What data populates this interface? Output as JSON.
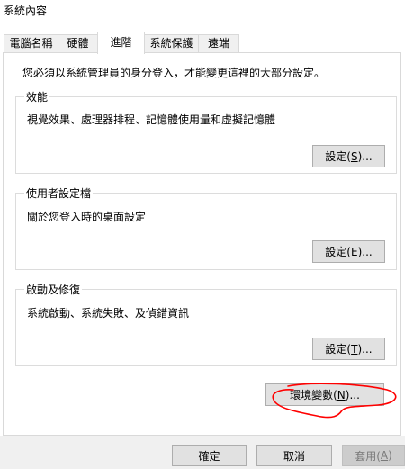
{
  "window": {
    "title": "系統內容"
  },
  "tabs": [
    {
      "label": "電腦名稱"
    },
    {
      "label": "硬體"
    },
    {
      "label": "進階"
    },
    {
      "label": "系統保護"
    },
    {
      "label": "遠端"
    }
  ],
  "active_tab": "進階",
  "advanced": {
    "notice": "您必須以系統管理員的身分登入，才能變更這裡的大部分設定。",
    "performance": {
      "title": "效能",
      "description": "視覺效果、處理器排程、記憶體使用量和虛擬記憶體",
      "button": {
        "text": "設定(",
        "accel": "S",
        "suffix": ")..."
      }
    },
    "user_profiles": {
      "title": "使用者設定檔",
      "description": "關於您登入時的桌面設定",
      "button": {
        "text": "設定(",
        "accel": "E",
        "suffix": ")..."
      }
    },
    "startup_recovery": {
      "title": "啟動及修復",
      "description": "系統啟動、系統失敗、及偵錯資訊",
      "button": {
        "text": "設定(",
        "accel": "T",
        "suffix": ")..."
      }
    },
    "env_vars_button": {
      "text": "環境變數(",
      "accel": "N",
      "suffix": ")..."
    }
  },
  "dialog_buttons": {
    "ok": "確定",
    "cancel": "取消",
    "apply": {
      "text": "套用(",
      "accel": "A",
      "suffix": ")"
    }
  },
  "annotation": {
    "shape": "red-ellipse-scribble",
    "color": "#ff0000",
    "target": "env-vars-button"
  },
  "colors": {
    "disabled_button": "#cccccc",
    "button": "#e1e1e1",
    "border": "#d9d9d9"
  }
}
